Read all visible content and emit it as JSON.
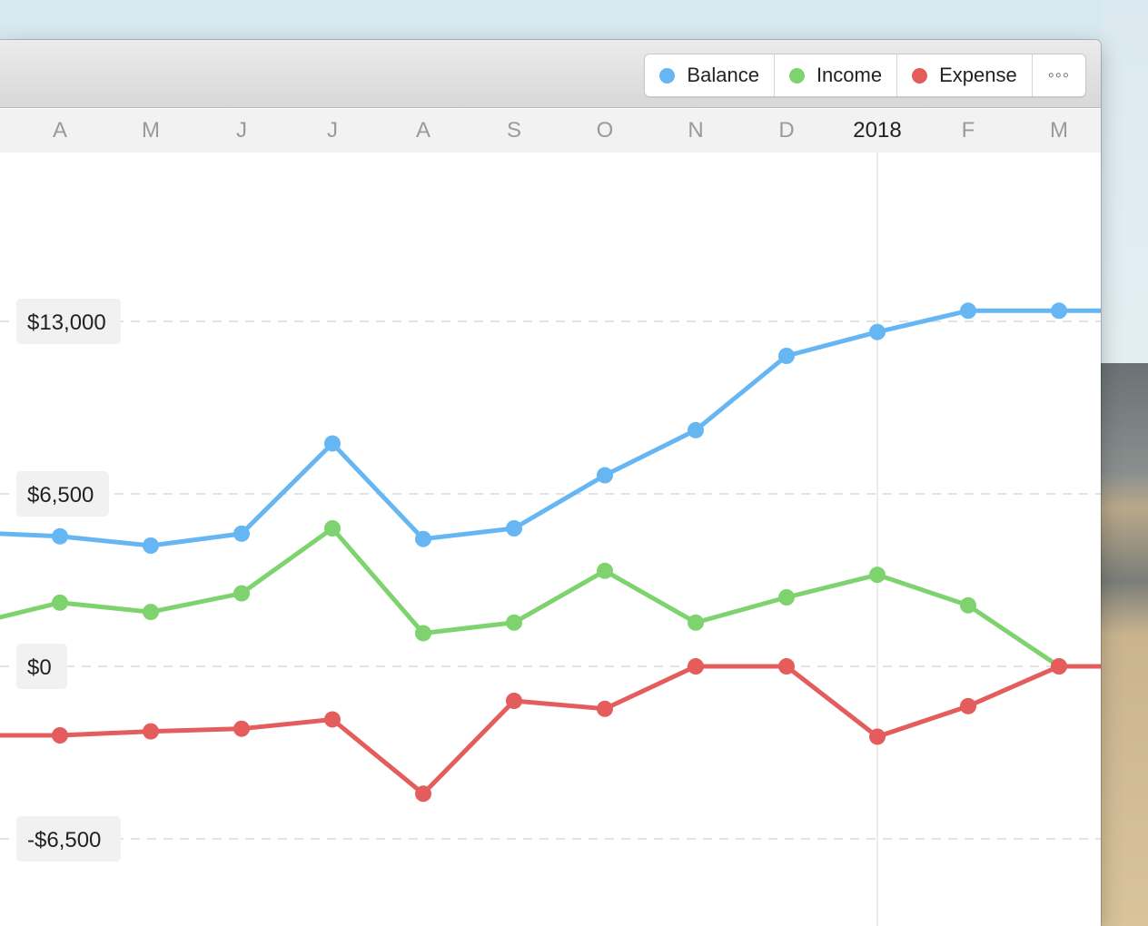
{
  "legend": {
    "items": [
      {
        "label": "Balance",
        "color": "#66b6f4"
      },
      {
        "label": "Income",
        "color": "#7fd36f"
      },
      {
        "label": "Expense",
        "color": "#e45c5c"
      }
    ],
    "more_label": "◦◦◦",
    "more_icon": "ellipsis-icon"
  },
  "timeline": {
    "months": [
      "A",
      "M",
      "J",
      "J",
      "A",
      "S",
      "O",
      "N",
      "D",
      "2018",
      "F",
      "M"
    ],
    "highlight": "2018"
  },
  "chart_data": {
    "type": "line",
    "categories": [
      "A",
      "M",
      "J",
      "J",
      "A",
      "S",
      "O",
      "N",
      "D",
      "2018",
      "F",
      "M"
    ],
    "y_tick_labels": [
      "$13,000",
      "$6,500",
      "$0",
      "-$6,500"
    ],
    "y_ticks": [
      13000,
      6500,
      0,
      -6500
    ],
    "ylim": [
      -13000,
      19500
    ],
    "grid": true,
    "legend_position": "top-right",
    "series": [
      {
        "name": "Balance",
        "color": "#66b6f4",
        "values": [
          4900,
          4550,
          5000,
          8400,
          4800,
          5200,
          7200,
          8900,
          11700,
          12600,
          13400,
          13400
        ],
        "lead_in": 5000,
        "trail": 13400
      },
      {
        "name": "Income",
        "color": "#7fd36f",
        "values": [
          2400,
          2050,
          2750,
          5200,
          1250,
          1650,
          3600,
          1650,
          2600,
          3450,
          2300,
          0
        ],
        "lead_in": 1850,
        "trail": null
      },
      {
        "name": "Expense",
        "color": "#e45c5c",
        "values": [
          -2600,
          -2450,
          -2350,
          -2000,
          -4800,
          -1300,
          -1600,
          0,
          0,
          -2650,
          -1500,
          0
        ],
        "lead_in": -2600,
        "trail": 0
      }
    ]
  }
}
